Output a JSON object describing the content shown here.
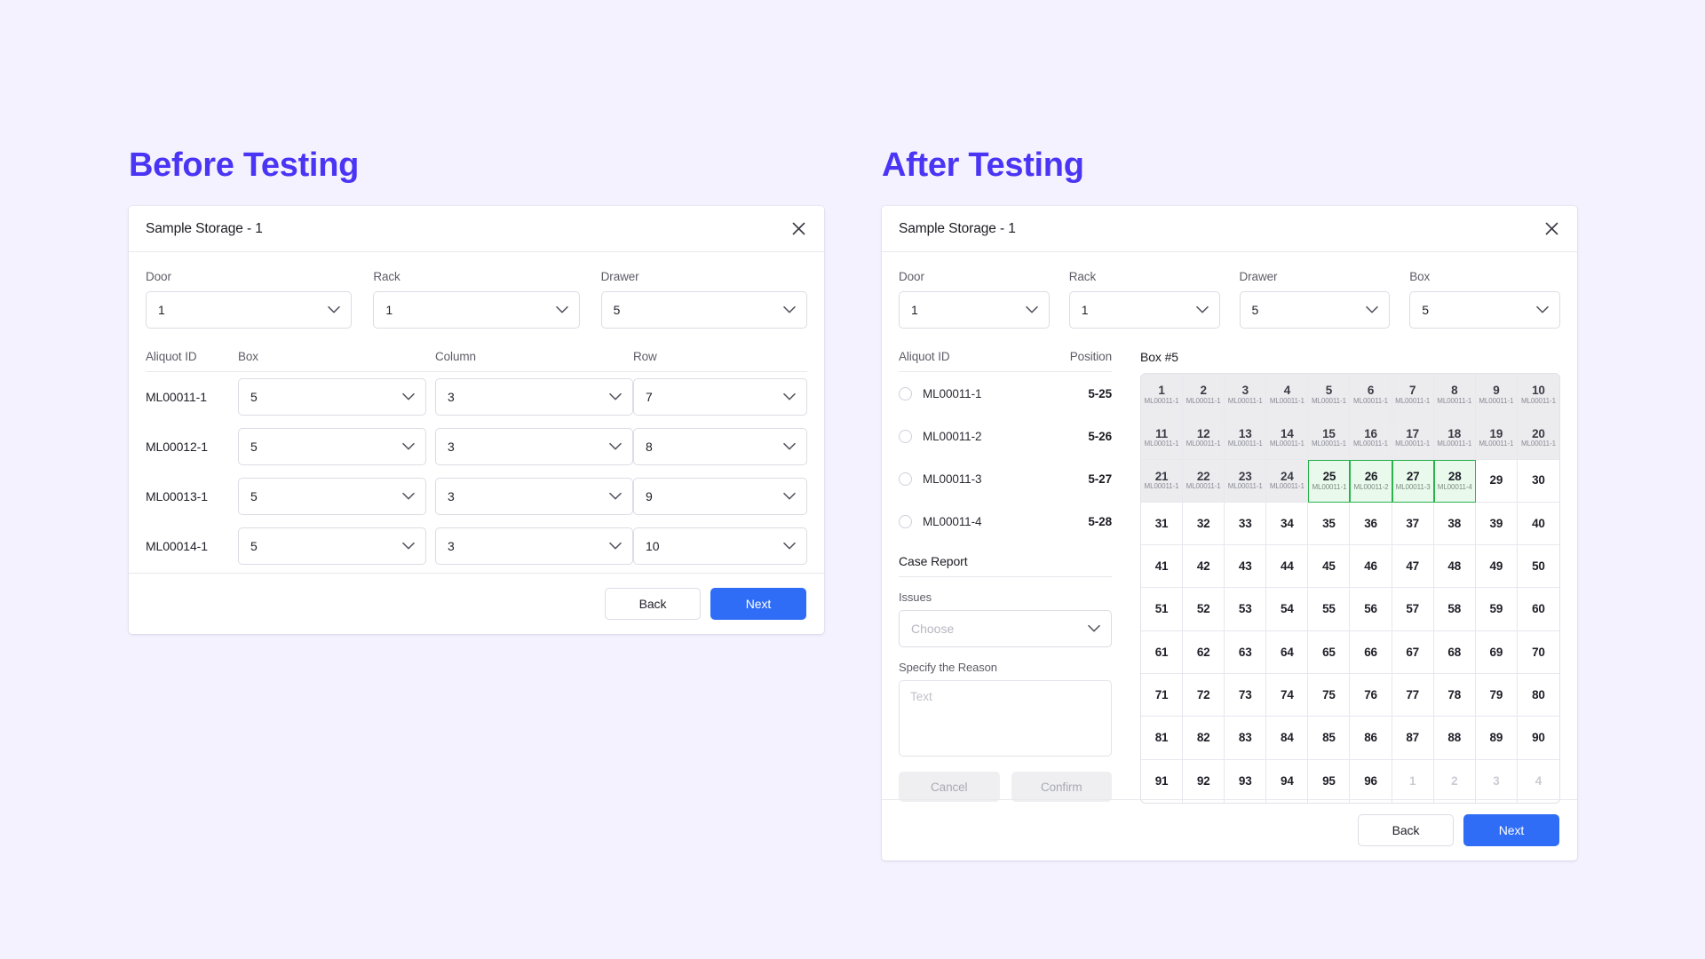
{
  "page": {
    "background_color": "#f4f2fe",
    "accent_color": "#4b35f5",
    "primary_button_color": "#2f6df6",
    "selection_color": "#2bb24c"
  },
  "sections": {
    "before_title": "Before Testing",
    "after_title": "After Testing"
  },
  "before_panel": {
    "title": "Sample Storage - 1",
    "close_icon": "close-icon",
    "selectors": [
      {
        "label": "Door",
        "value": "1"
      },
      {
        "label": "Rack",
        "value": "1"
      },
      {
        "label": "Drawer",
        "value": "5"
      }
    ],
    "table": {
      "headers": [
        "Aliquot ID",
        "Box",
        "Column",
        "Row"
      ],
      "rows": [
        {
          "aliquot_id": "ML00011-1",
          "box": "5",
          "column": "3",
          "row": "7"
        },
        {
          "aliquot_id": "ML00012-1",
          "box": "5",
          "column": "3",
          "row": "8"
        },
        {
          "aliquot_id": "ML00013-1",
          "box": "5",
          "column": "3",
          "row": "9"
        },
        {
          "aliquot_id": "ML00014-1",
          "box": "5",
          "column": "3",
          "row": "10"
        }
      ]
    },
    "footer": {
      "back_label": "Back",
      "next_label": "Next"
    }
  },
  "after_panel": {
    "title": "Sample Storage - 1",
    "close_icon": "close-icon",
    "selectors": [
      {
        "label": "Door",
        "value": "1"
      },
      {
        "label": "Rack",
        "value": "1"
      },
      {
        "label": "Drawer",
        "value": "5"
      },
      {
        "label": "Box",
        "value": "5"
      }
    ],
    "aliquot_list": {
      "headers": [
        "Aliquot ID",
        "Position"
      ],
      "rows": [
        {
          "aliquot_id": "ML00011-1",
          "position": "5-25",
          "selected": false
        },
        {
          "aliquot_id": "ML00011-2",
          "position": "5-26",
          "selected": false
        },
        {
          "aliquot_id": "ML00011-3",
          "position": "5-27",
          "selected": false
        },
        {
          "aliquot_id": "ML00011-4",
          "position": "5-28",
          "selected": false
        }
      ]
    },
    "case_report": {
      "heading": "Case Report",
      "issues_label": "Issues",
      "issues_placeholder": "Choose",
      "issues_value": "",
      "reason_label": "Specify the Reason",
      "reason_placeholder": "Text",
      "reason_value": "",
      "cancel_label": "Cancel",
      "confirm_label": "Confirm"
    },
    "box_grid": {
      "title": "Box #5",
      "columns": 10,
      "rows": 10,
      "cells": [
        {
          "n": "1",
          "tag": "ML00011-1",
          "state": "occupied"
        },
        {
          "n": "2",
          "tag": "ML00011-1",
          "state": "occupied"
        },
        {
          "n": "3",
          "tag": "ML00011-1",
          "state": "occupied"
        },
        {
          "n": "4",
          "tag": "ML00011-1",
          "state": "occupied"
        },
        {
          "n": "5",
          "tag": "ML00011-1",
          "state": "occupied"
        },
        {
          "n": "6",
          "tag": "ML00011-1",
          "state": "occupied"
        },
        {
          "n": "7",
          "tag": "ML00011-1",
          "state": "occupied"
        },
        {
          "n": "8",
          "tag": "ML00011-1",
          "state": "occupied"
        },
        {
          "n": "9",
          "tag": "ML00011-1",
          "state": "occupied"
        },
        {
          "n": "10",
          "tag": "ML00011-1",
          "state": "occupied"
        },
        {
          "n": "11",
          "tag": "ML00011-1",
          "state": "occupied"
        },
        {
          "n": "12",
          "tag": "ML00011-1",
          "state": "occupied"
        },
        {
          "n": "13",
          "tag": "ML00011-1",
          "state": "occupied"
        },
        {
          "n": "14",
          "tag": "ML00011-1",
          "state": "occupied"
        },
        {
          "n": "15",
          "tag": "ML00011-1",
          "state": "occupied"
        },
        {
          "n": "16",
          "tag": "ML00011-1",
          "state": "occupied"
        },
        {
          "n": "17",
          "tag": "ML00011-1",
          "state": "occupied"
        },
        {
          "n": "18",
          "tag": "ML00011-1",
          "state": "occupied"
        },
        {
          "n": "19",
          "tag": "ML00011-1",
          "state": "occupied"
        },
        {
          "n": "20",
          "tag": "ML00011-1",
          "state": "occupied"
        },
        {
          "n": "21",
          "tag": "ML00011-1",
          "state": "occupied"
        },
        {
          "n": "22",
          "tag": "ML00011-1",
          "state": "occupied"
        },
        {
          "n": "23",
          "tag": "ML00011-1",
          "state": "occupied"
        },
        {
          "n": "24",
          "tag": "ML00011-1",
          "state": "occupied"
        },
        {
          "n": "25",
          "tag": "ML00011-1",
          "state": "selected"
        },
        {
          "n": "26",
          "tag": "ML00011-2",
          "state": "selected"
        },
        {
          "n": "27",
          "tag": "ML00011-3",
          "state": "selected"
        },
        {
          "n": "28",
          "tag": "ML00011-4",
          "state": "selected"
        },
        {
          "n": "29",
          "tag": "",
          "state": "empty"
        },
        {
          "n": "30",
          "tag": "",
          "state": "empty"
        },
        {
          "n": "31",
          "tag": "",
          "state": "empty"
        },
        {
          "n": "32",
          "tag": "",
          "state": "empty"
        },
        {
          "n": "33",
          "tag": "",
          "state": "empty"
        },
        {
          "n": "34",
          "tag": "",
          "state": "empty"
        },
        {
          "n": "35",
          "tag": "",
          "state": "empty"
        },
        {
          "n": "36",
          "tag": "",
          "state": "empty"
        },
        {
          "n": "37",
          "tag": "",
          "state": "empty"
        },
        {
          "n": "38",
          "tag": "",
          "state": "empty"
        },
        {
          "n": "39",
          "tag": "",
          "state": "empty"
        },
        {
          "n": "40",
          "tag": "",
          "state": "empty"
        },
        {
          "n": "41",
          "tag": "",
          "state": "empty"
        },
        {
          "n": "42",
          "tag": "",
          "state": "empty"
        },
        {
          "n": "43",
          "tag": "",
          "state": "empty"
        },
        {
          "n": "44",
          "tag": "",
          "state": "empty"
        },
        {
          "n": "45",
          "tag": "",
          "state": "empty"
        },
        {
          "n": "46",
          "tag": "",
          "state": "empty"
        },
        {
          "n": "47",
          "tag": "",
          "state": "empty"
        },
        {
          "n": "48",
          "tag": "",
          "state": "empty"
        },
        {
          "n": "49",
          "tag": "",
          "state": "empty"
        },
        {
          "n": "50",
          "tag": "",
          "state": "empty"
        },
        {
          "n": "51",
          "tag": "",
          "state": "empty"
        },
        {
          "n": "52",
          "tag": "",
          "state": "empty"
        },
        {
          "n": "53",
          "tag": "",
          "state": "empty"
        },
        {
          "n": "54",
          "tag": "",
          "state": "empty"
        },
        {
          "n": "55",
          "tag": "",
          "state": "empty"
        },
        {
          "n": "56",
          "tag": "",
          "state": "empty"
        },
        {
          "n": "57",
          "tag": "",
          "state": "empty"
        },
        {
          "n": "58",
          "tag": "",
          "state": "empty"
        },
        {
          "n": "59",
          "tag": "",
          "state": "empty"
        },
        {
          "n": "60",
          "tag": "",
          "state": "empty"
        },
        {
          "n": "61",
          "tag": "",
          "state": "empty"
        },
        {
          "n": "62",
          "tag": "",
          "state": "empty"
        },
        {
          "n": "63",
          "tag": "",
          "state": "empty"
        },
        {
          "n": "64",
          "tag": "",
          "state": "empty"
        },
        {
          "n": "65",
          "tag": "",
          "state": "empty"
        },
        {
          "n": "66",
          "tag": "",
          "state": "empty"
        },
        {
          "n": "67",
          "tag": "",
          "state": "empty"
        },
        {
          "n": "68",
          "tag": "",
          "state": "empty"
        },
        {
          "n": "69",
          "tag": "",
          "state": "empty"
        },
        {
          "n": "70",
          "tag": "",
          "state": "empty"
        },
        {
          "n": "71",
          "tag": "",
          "state": "empty"
        },
        {
          "n": "72",
          "tag": "",
          "state": "empty"
        },
        {
          "n": "73",
          "tag": "",
          "state": "empty"
        },
        {
          "n": "74",
          "tag": "",
          "state": "empty"
        },
        {
          "n": "75",
          "tag": "",
          "state": "empty"
        },
        {
          "n": "76",
          "tag": "",
          "state": "empty"
        },
        {
          "n": "77",
          "tag": "",
          "state": "empty"
        },
        {
          "n": "78",
          "tag": "",
          "state": "empty"
        },
        {
          "n": "79",
          "tag": "",
          "state": "empty"
        },
        {
          "n": "80",
          "tag": "",
          "state": "empty"
        },
        {
          "n": "81",
          "tag": "",
          "state": "empty"
        },
        {
          "n": "82",
          "tag": "",
          "state": "empty"
        },
        {
          "n": "83",
          "tag": "",
          "state": "empty"
        },
        {
          "n": "84",
          "tag": "",
          "state": "empty"
        },
        {
          "n": "85",
          "tag": "",
          "state": "empty"
        },
        {
          "n": "86",
          "tag": "",
          "state": "empty"
        },
        {
          "n": "87",
          "tag": "",
          "state": "empty"
        },
        {
          "n": "88",
          "tag": "",
          "state": "empty"
        },
        {
          "n": "89",
          "tag": "",
          "state": "empty"
        },
        {
          "n": "90",
          "tag": "",
          "state": "empty"
        },
        {
          "n": "91",
          "tag": "",
          "state": "empty"
        },
        {
          "n": "92",
          "tag": "",
          "state": "empty"
        },
        {
          "n": "93",
          "tag": "",
          "state": "empty"
        },
        {
          "n": "94",
          "tag": "",
          "state": "empty"
        },
        {
          "n": "95",
          "tag": "",
          "state": "empty"
        },
        {
          "n": "96",
          "tag": "",
          "state": "empty"
        },
        {
          "n": "1",
          "tag": "",
          "state": "faded"
        },
        {
          "n": "2",
          "tag": "",
          "state": "faded"
        },
        {
          "n": "3",
          "tag": "",
          "state": "faded"
        },
        {
          "n": "4",
          "tag": "",
          "state": "faded"
        }
      ]
    },
    "footer": {
      "back_label": "Back",
      "next_label": "Next"
    }
  }
}
